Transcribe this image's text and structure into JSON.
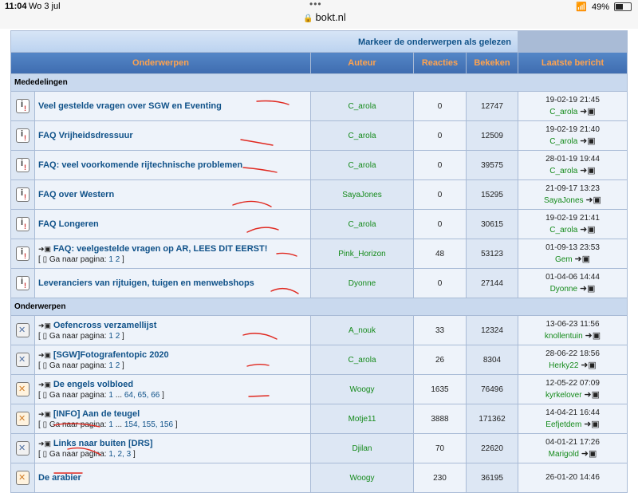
{
  "status": {
    "time": "11:04",
    "date": "Wo 3 jul",
    "url": "bokt.nl",
    "battery": "49%"
  },
  "board": {
    "mark_link": "Markeer de onderwerpen als gelezen",
    "columns": {
      "topics": "Onderwerpen",
      "author": "Auteur",
      "replies": "Reacties",
      "views": "Bekeken",
      "last": "Laatste bericht"
    },
    "categories": {
      "announcements": "Mededelingen",
      "topics": "Onderwerpen"
    },
    "goto_label": "Ga naar pagina:",
    "announcements": [
      {
        "title": "Veel gestelde vragen over SGW en Eventing",
        "author": "C_arola",
        "replies": "0",
        "views": "12747",
        "last_date": "19-02-19 21:45",
        "last_user": "C_arola"
      },
      {
        "title": "FAQ Vrijheidsdressuur",
        "author": "C_arola",
        "replies": "0",
        "views": "12509",
        "last_date": "19-02-19 21:40",
        "last_user": "C_arola"
      },
      {
        "title": "FAQ: veel voorkomende rijtechnische problemen",
        "author": "C_arola",
        "replies": "0",
        "views": "39575",
        "last_date": "28-01-19 19:44",
        "last_user": "C_arola"
      },
      {
        "title": "FAQ over Western",
        "author": "SayaJones",
        "replies": "0",
        "views": "15295",
        "last_date": "21-09-17 13:23",
        "last_user": "SayaJones"
      },
      {
        "title": "FAQ Longeren",
        "author": "C_arola",
        "replies": "0",
        "views": "30615",
        "last_date": "19-02-19 21:41",
        "last_user": "C_arola"
      },
      {
        "title": "FAQ: veelgestelde vragen op AR, LEES DIT EERST!",
        "author": "Pink_Horizon",
        "replies": "48",
        "views": "53123",
        "last_date": "01-09-13 23:53",
        "last_user": "Gem",
        "pages": [
          "1",
          "2"
        ]
      },
      {
        "title": "Leveranciers van rijtuigen, tuigen en menwebshops",
        "author": "Dyonne",
        "replies": "0",
        "views": "27144",
        "last_date": "01-04-06 14:44",
        "last_user": "Dyonne"
      }
    ],
    "topics": [
      {
        "title": "Oefencross verzamellijst",
        "author": "A_nouk",
        "replies": "33",
        "views": "12324",
        "last_date": "13-06-23 11:56",
        "last_user": "knollentuin",
        "pages": [
          "1",
          "2"
        ]
      },
      {
        "title": "[SGW]Fotografentopic 2020",
        "author": "C_arola",
        "replies": "26",
        "views": "8304",
        "last_date": "28-06-22 18:56",
        "last_user": "Herky22",
        "pages": [
          "1",
          "2"
        ]
      },
      {
        "title": "De engels volbloed",
        "author": "Woogy",
        "replies": "1635",
        "views": "76496",
        "last_date": "12-05-22 07:09",
        "last_user": "kyrkelover",
        "pages": [
          "1",
          "...",
          "64,",
          "65,",
          "66"
        ]
      },
      {
        "title": "[INFO] Aan de teugel",
        "author": "Motje11",
        "replies": "3888",
        "views": "171362",
        "last_date": "14-04-21 16:44",
        "last_user": "Eefjetdem",
        "pages": [
          "1",
          "...",
          "154,",
          "155,",
          "156"
        ]
      },
      {
        "title": "Links naar buiten [DRS]",
        "author": "Djilan",
        "replies": "70",
        "views": "22620",
        "last_date": "04-01-21 17:26",
        "last_user": "Marigold",
        "pages": [
          "1,",
          "2,",
          "3"
        ]
      },
      {
        "title": "De arabier",
        "author": "Woogy",
        "replies": "230",
        "views": "36195",
        "last_date": "26-01-20 14:46",
        "last_user": ""
      }
    ]
  },
  "colors": {
    "header_bg": "#4a7bc0",
    "header_text": "#ffa34f",
    "link": "#105289",
    "username": "#148a1a",
    "border": "#a9bbd6"
  },
  "icons": {
    "announcement": "announcement-icon",
    "topic": "topic-icon",
    "hot_topic": "hot-topic-icon",
    "goto_new": "goto-newest-post-icon",
    "lock": "lock-icon",
    "wifi": "wifi-icon",
    "battery": "battery-icon"
  }
}
